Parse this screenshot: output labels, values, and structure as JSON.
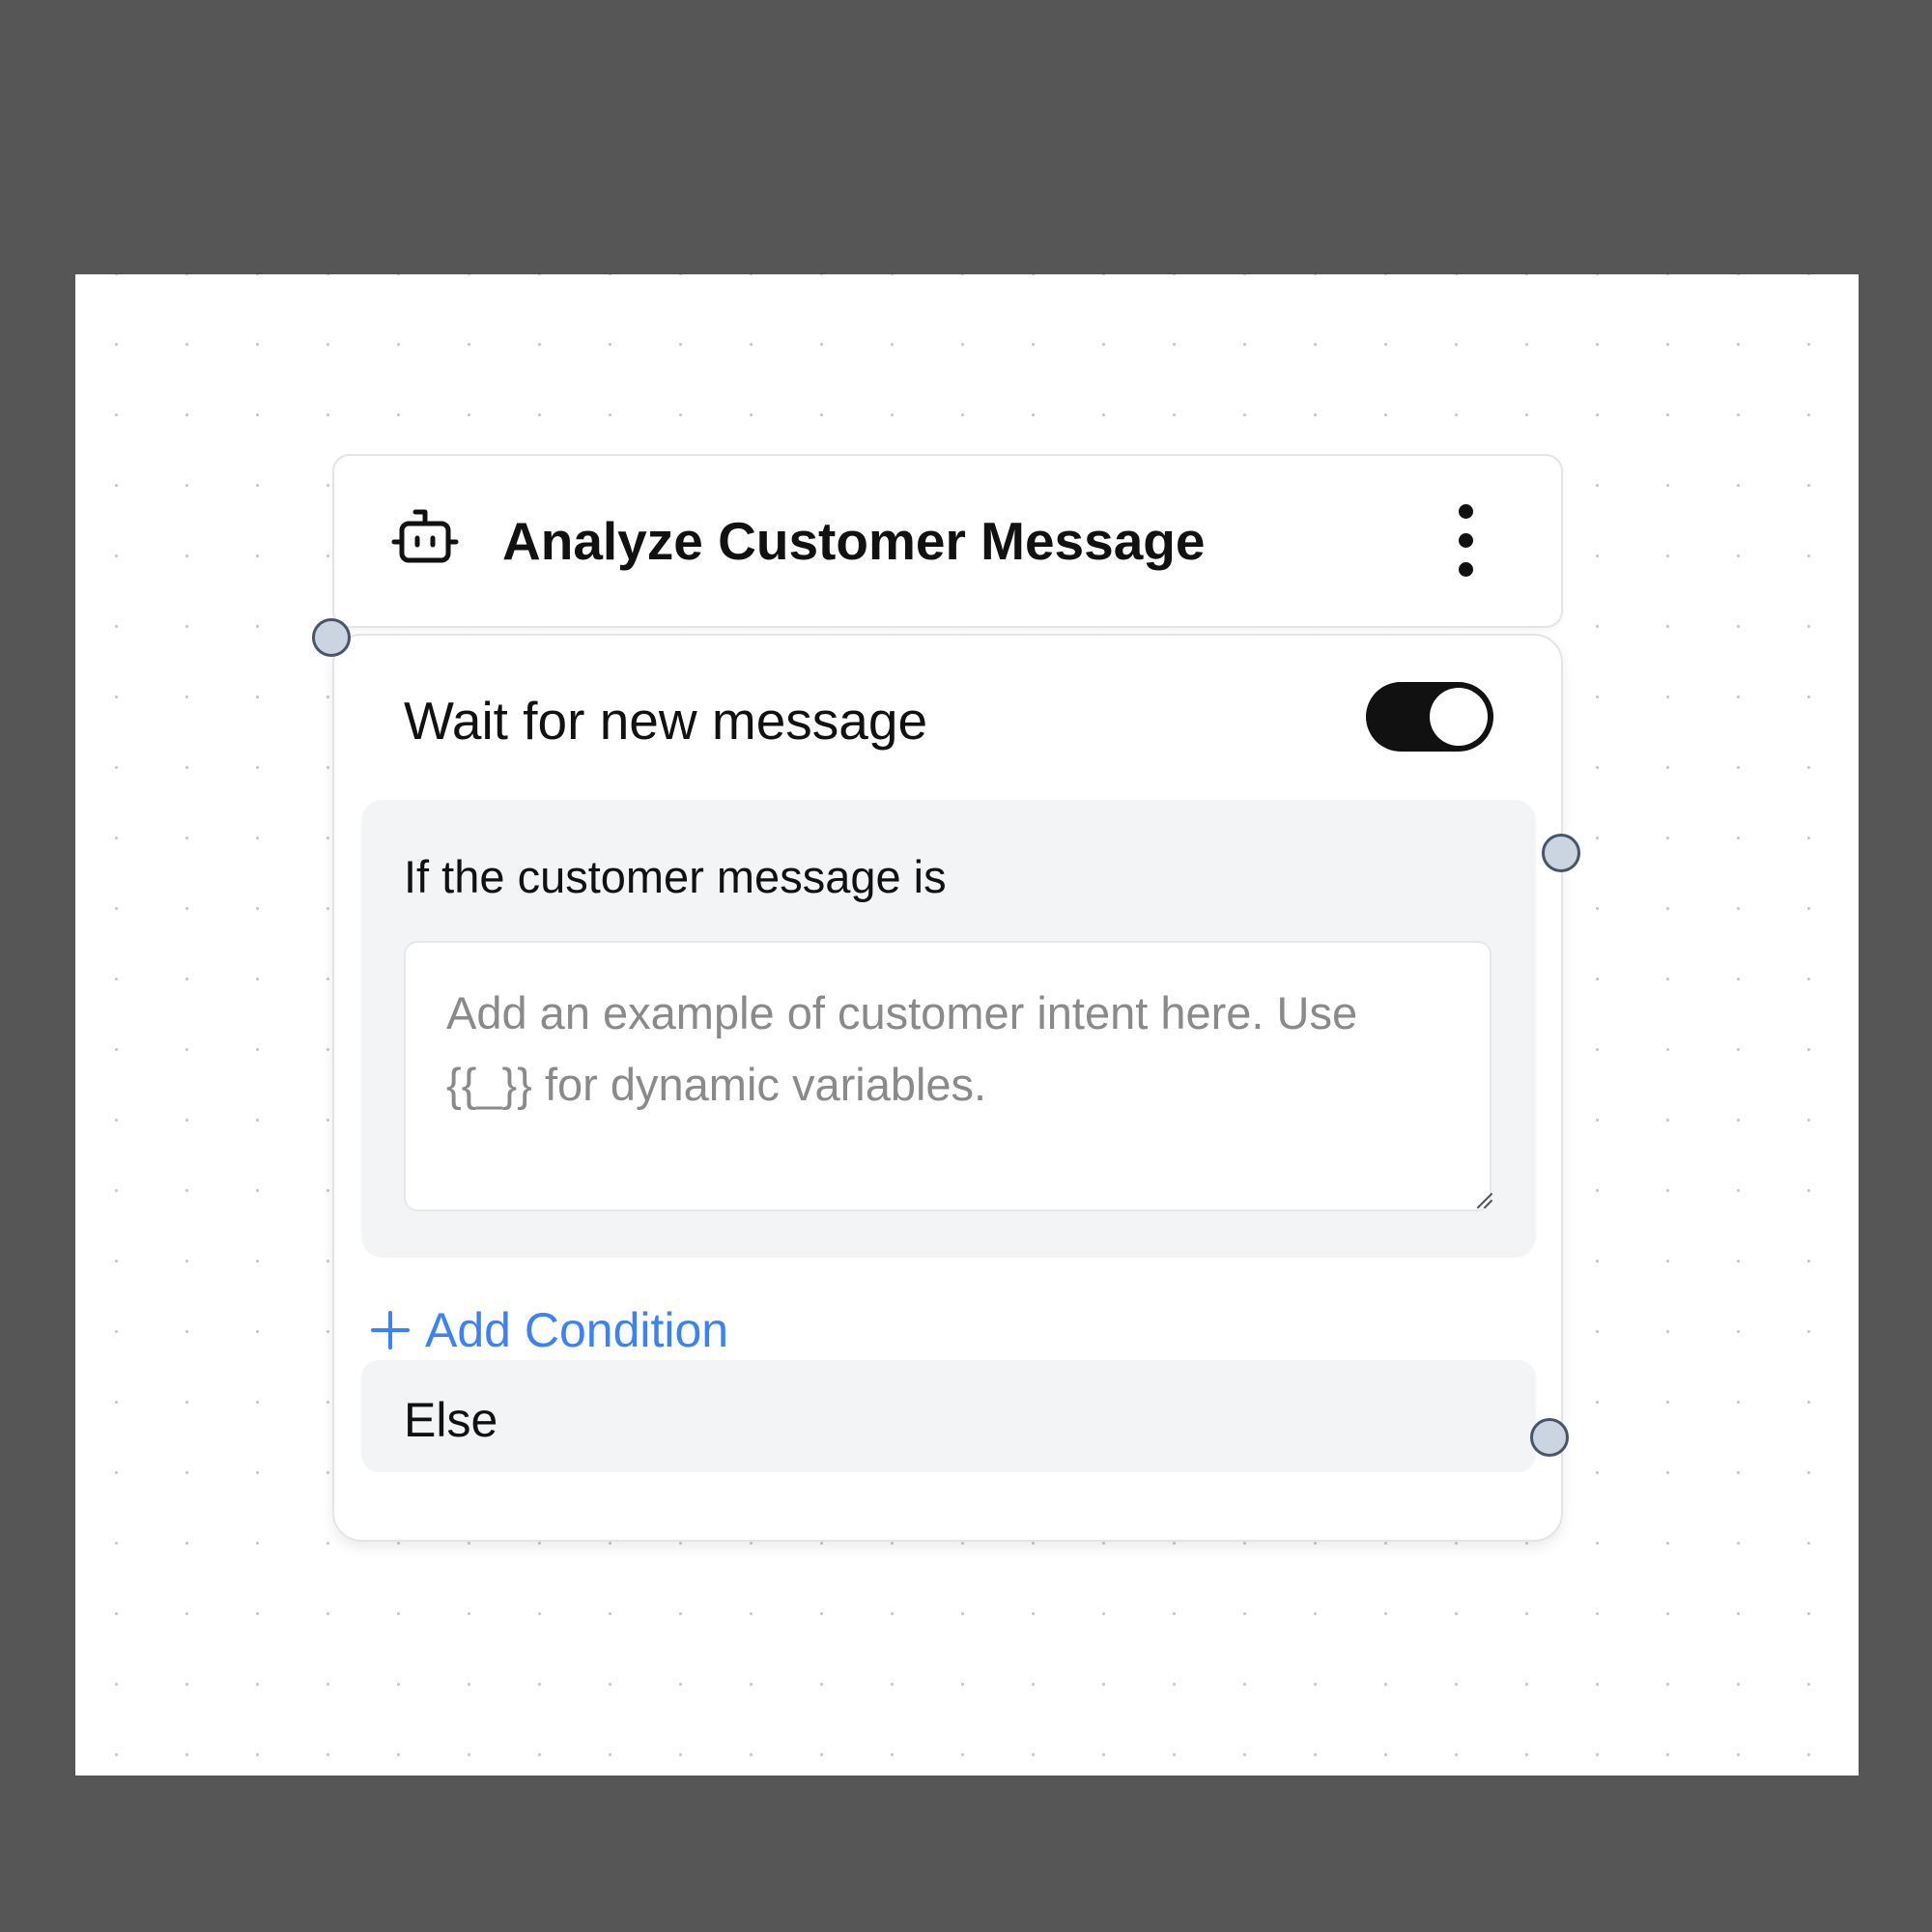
{
  "node": {
    "title": "Analyze Customer Message",
    "icon": "bot-icon",
    "menu_icon": "more-vertical-icon"
  },
  "wait_toggle": {
    "label": "Wait for new message",
    "enabled": true
  },
  "condition": {
    "label": "If the customer message is",
    "value": "",
    "placeholder": "Add an example of customer intent here. Use {{_}} for dynamic variables."
  },
  "add_condition": {
    "label": "Add Condition",
    "icon": "plus-icon"
  },
  "else_branch": {
    "label": "Else"
  },
  "colors": {
    "accent": "#3b82f6",
    "toggle_on": "#111111",
    "handle_fill": "#cbd5e1",
    "panel_bg": "#f3f4f6",
    "backdrop": "#565656"
  }
}
